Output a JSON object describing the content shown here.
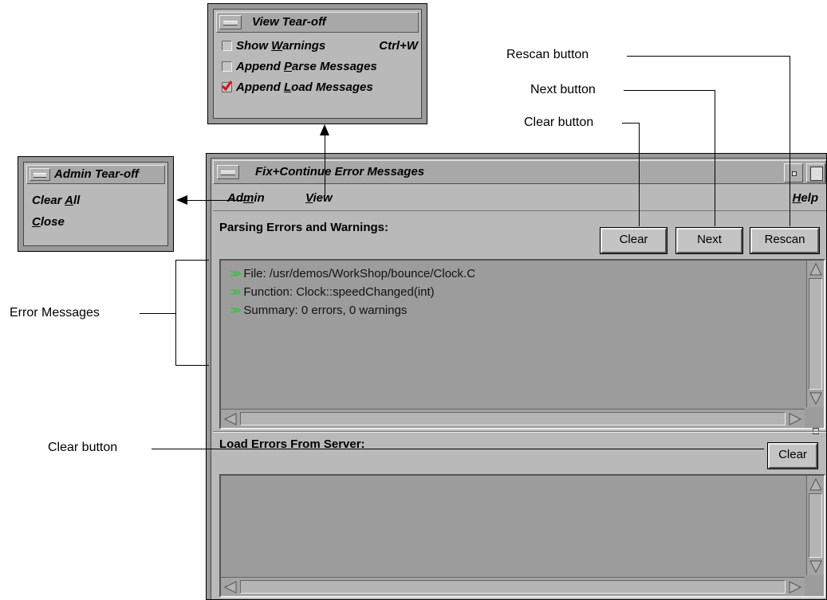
{
  "view_tearoff": {
    "title": "View Tear-off",
    "items": [
      {
        "label": "Show Warnings",
        "mnemonic": "W",
        "shortcut": "Ctrl+W",
        "checked": false
      },
      {
        "label": "Append Parse Messages",
        "mnemonic": "P",
        "checked": false
      },
      {
        "label": "Append Load Messages",
        "mnemonic": "L",
        "checked": true
      }
    ]
  },
  "admin_tearoff": {
    "title": "Admin Tear-off",
    "items": [
      {
        "label": "Clear All",
        "mnemonic": "A"
      },
      {
        "label": "Close",
        "mnemonic": "C"
      }
    ]
  },
  "window": {
    "title": "Fix+Continue Error Messages",
    "menubar": {
      "admin": "Admin",
      "view": "View",
      "help": "Help"
    },
    "parsing": {
      "label": "Parsing Errors and Warnings:",
      "buttons": {
        "clear": "Clear",
        "next": "Next",
        "rescan": "Rescan"
      },
      "messages": [
        "File: /usr/demos/WorkShop/bounce/Clock.C",
        "Function: Clock::speedChanged(int)",
        "Summary: 0 errors, 0 warnings"
      ]
    },
    "load": {
      "label": "Load Errors From Server:",
      "clear": "Clear"
    }
  },
  "callouts": {
    "rescan": "Rescan button",
    "next": "Next button",
    "clear_top": "Clear button",
    "error_messages": "Error Messages",
    "clear_bottom": "Clear button"
  },
  "colors": {
    "message_arrow": "#39c23a"
  }
}
